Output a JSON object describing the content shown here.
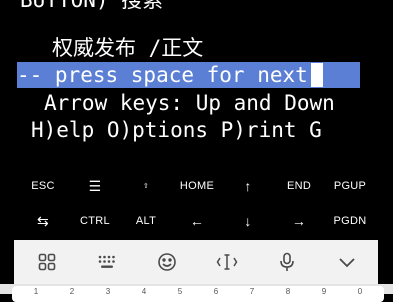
{
  "terminal": {
    "lines": [
      "BUTTON) 搜索",
      "权威发布 /正文",
      "-- press space for next",
      "Arrow keys: Up and Down",
      "H)elp O)ptions P)rint G"
    ]
  },
  "extra_keys": {
    "row1": [
      "ESC",
      "☰",
      "⇧",
      "HOME",
      "↑",
      "END",
      "PGUP"
    ],
    "row2": [
      "⇆",
      "CTRL",
      "ALT",
      "←",
      "↓",
      "→",
      "PGDN"
    ]
  },
  "keyboard_toolbar": {
    "icons": [
      "apps-grid-icon",
      "keyboard-icon",
      "emoji-icon",
      "text-cursor-icon",
      "microphone-icon",
      "collapse-chevron-icon"
    ]
  },
  "number_row": [
    "1",
    "2",
    "3",
    "4",
    "5",
    "6",
    "7",
    "8",
    "9",
    "0"
  ],
  "colors": {
    "terminal_bg": "#000000",
    "highlight": "#5b7fd4",
    "toolbar_bg": "#f2f2f2"
  }
}
